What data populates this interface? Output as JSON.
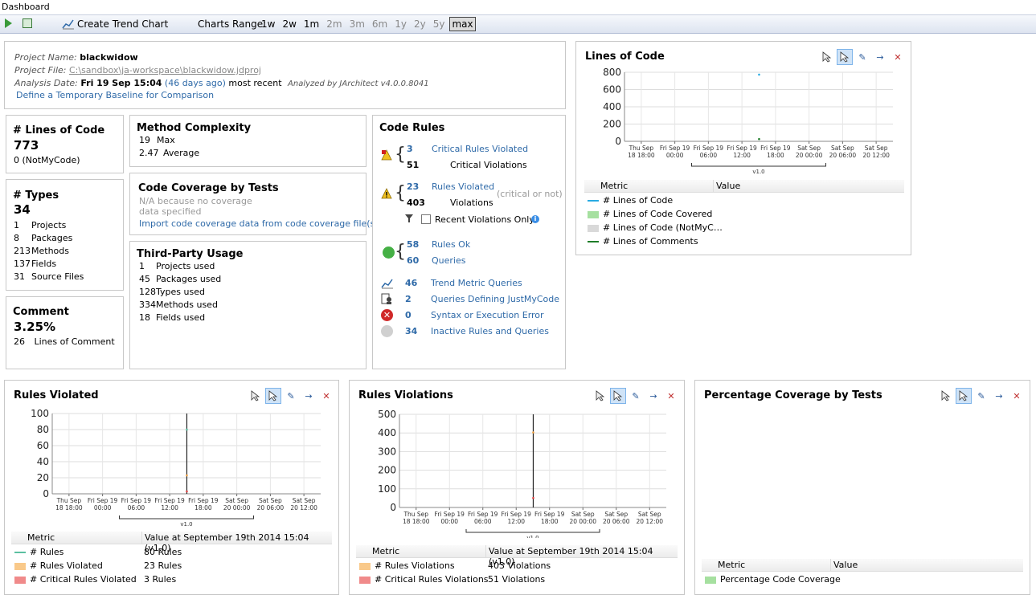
{
  "window": {
    "title": "Dashboard"
  },
  "toolbar": {
    "create_trend_chart": "Create Trend Chart",
    "charts_range_label": "Charts Range:",
    "ranges": [
      "1w",
      "2w",
      "1m",
      "2m",
      "3m",
      "6m",
      "1y",
      "2y",
      "5y",
      "max"
    ],
    "selected_range": "max"
  },
  "project": {
    "name_label": "Project Name:",
    "name": "blackwidow",
    "file_label": "Project File:",
    "file": "C:\\sandbox\\ja-workspace\\blackwidow.jdproj",
    "date_label": "Analysis Date:",
    "date": "Fri 19 Sep  15:04",
    "days_ago": "(46 days ago)",
    "most_recent": "most recent",
    "analyzed_by": "Analyzed by JArchitect v4.0.0.8041",
    "baseline_link": "Define a Temporary Baseline for Comparison"
  },
  "loc": {
    "title": "# Lines of Code",
    "value": "773",
    "notmycode": "0  (NotMyCode)"
  },
  "types": {
    "title": "# Types",
    "value": "34",
    "items": [
      {
        "n": "1",
        "label": "Projects"
      },
      {
        "n": "8",
        "label": "Packages"
      },
      {
        "n": "213",
        "label": "Methods"
      },
      {
        "n": "137",
        "label": "Fields"
      },
      {
        "n": "31",
        "label": "Source Files"
      }
    ]
  },
  "comment": {
    "title": "Comment",
    "value": "3.25%",
    "lines": "26",
    "lines_label": "Lines of Comment"
  },
  "method_complexity": {
    "title": "Method Complexity",
    "max_n": "19",
    "max_label": "Max",
    "avg_n": "2.47",
    "avg_label": "Average"
  },
  "coverage": {
    "title": "Code Coverage by Tests",
    "na1": "N/A because no coverage",
    "na2": "data specified",
    "import_link": "Import code coverage data from code coverage file(s)"
  },
  "third_party": {
    "title": "Third-Party Usage",
    "items": [
      {
        "n": "1",
        "label": "Projects used"
      },
      {
        "n": "45",
        "label": "Packages used"
      },
      {
        "n": "128",
        "label": "Types used"
      },
      {
        "n": "334",
        "label": "Methods used"
      },
      {
        "n": "18",
        "label": "Fields used"
      }
    ]
  },
  "code_rules": {
    "title": "Code Rules",
    "critical_n": "3",
    "critical_label": "Critical Rules Violated",
    "critical_viol_n": "51",
    "critical_viol_label": "Critical Violations",
    "violated_n": "23",
    "violated_label": "Rules Violated",
    "viol_n": "403",
    "viol_label": "Violations",
    "critical_or_not": "(critical or not)",
    "recent_only": "Recent Violations Only",
    "ok_n": "58",
    "ok_label": "Rules Ok",
    "queries_n": "60",
    "queries_label": "Queries",
    "trend_n": "46",
    "trend_label": "Trend Metric Queries",
    "jmc_n": "2",
    "jmc_label": "Queries Defining JustMyCode",
    "syntax_n": "0",
    "syntax_label": "Syntax or Execution Error",
    "inactive_n": "34",
    "inactive_label": "Inactive Rules and Queries"
  },
  "x_ticks": [
    [
      "Thu Sep",
      "18 18:00"
    ],
    [
      "Fri Sep 19",
      "00:00"
    ],
    [
      "Fri Sep 19",
      "06:00"
    ],
    [
      "Fri Sep 19",
      "12:00"
    ],
    [
      "Fri Sep 19",
      "18:00"
    ],
    [
      "Sat Sep",
      "20 00:00"
    ],
    [
      "Sat Sep",
      "20 06:00"
    ],
    [
      "Sat Sep",
      "20 12:00"
    ]
  ],
  "version_label": "v1.0",
  "loc_chart": {
    "title": "Lines of Code",
    "metric_header": "Metric",
    "value_header": "Value",
    "legend": [
      {
        "name": "# Lines of Code",
        "color": "#29abe2",
        "kind": "line",
        "value": ""
      },
      {
        "name": "# Lines of Code Covered",
        "color": "#a6e0a0",
        "kind": "box",
        "value": ""
      },
      {
        "name": "# Lines of Code (NotMyC…",
        "color": "#d9d9d9",
        "kind": "box",
        "value": ""
      },
      {
        "name": "# Lines of Comments",
        "color": "#1e7d28",
        "kind": "line",
        "value": ""
      }
    ]
  },
  "rules_violated_chart": {
    "title": "Rules Violated",
    "metric_header": "Metric",
    "value_header": "Value at September 19th 2014  15:04  (v1.0)",
    "legend": [
      {
        "name": "# Rules",
        "color": "#5bc0a0",
        "kind": "line",
        "value": "80 Rules"
      },
      {
        "name": "# Rules Violated",
        "color": "#f9c98a",
        "kind": "box",
        "value": "23 Rules"
      },
      {
        "name": "# Critical Rules Violated",
        "color": "#f08a8a",
        "kind": "box",
        "value": "3 Rules"
      }
    ]
  },
  "rules_violations_chart": {
    "title": "Rules Violations",
    "metric_header": "Metric",
    "value_header": "Value at September 19th 2014  15:04  (v1.0)",
    "legend": [
      {
        "name": "# Rules Violations",
        "color": "#f9c98a",
        "kind": "box",
        "value": "403 Violations"
      },
      {
        "name": "# Critical Rules Violations",
        "color": "#f08a8a",
        "kind": "box",
        "value": "51 Violations"
      }
    ]
  },
  "coverage_chart": {
    "title": "Percentage Coverage by Tests",
    "metric_header": "Metric",
    "value_header": "Value",
    "legend": [
      {
        "name": "Percentage Code Coverage",
        "color": "#a6e0a0",
        "kind": "box",
        "value": ""
      }
    ]
  },
  "chart_data": [
    {
      "type": "line",
      "title": "Lines of Code",
      "x_ticks": [
        "Thu Sep 18 18:00",
        "Fri Sep 19 00:00",
        "Fri Sep 19 06:00",
        "Fri Sep 19 12:00",
        "Fri Sep 19 18:00",
        "Sat Sep 20 00:00",
        "Sat Sep 20 06:00",
        "Sat Sep 20 12:00"
      ],
      "ylim": [
        0,
        800
      ],
      "yticks": [
        0,
        200,
        400,
        600,
        800
      ],
      "series": [
        {
          "name": "# Lines of Code",
          "x": [
            "Fri Sep 19 15:04"
          ],
          "values": [
            773
          ]
        },
        {
          "name": "# Lines of Comments",
          "x": [
            "Fri Sep 19 15:04"
          ],
          "values": [
            26
          ]
        }
      ]
    },
    {
      "type": "line",
      "title": "Rules Violated",
      "x_ticks": [
        "Thu Sep 18 18:00",
        "Fri Sep 19 00:00",
        "Fri Sep 19 06:00",
        "Fri Sep 19 12:00",
        "Fri Sep 19 18:00",
        "Sat Sep 20 00:00",
        "Sat Sep 20 06:00",
        "Sat Sep 20 12:00"
      ],
      "ylim": [
        0,
        100
      ],
      "yticks": [
        0,
        20,
        40,
        60,
        80,
        100
      ],
      "series": [
        {
          "name": "# Rules",
          "x": [
            "Fri Sep 19 15:04"
          ],
          "values": [
            80
          ]
        },
        {
          "name": "# Rules Violated",
          "x": [
            "Fri Sep 19 15:04"
          ],
          "values": [
            23
          ]
        },
        {
          "name": "# Critical Rules Violated",
          "x": [
            "Fri Sep 19 15:04"
          ],
          "values": [
            3
          ]
        }
      ]
    },
    {
      "type": "line",
      "title": "Rules Violations",
      "x_ticks": [
        "Thu Sep 18 18:00",
        "Fri Sep 19 00:00",
        "Fri Sep 19 06:00",
        "Fri Sep 19 12:00",
        "Fri Sep 19 18:00",
        "Sat Sep 20 00:00",
        "Sat Sep 20 06:00",
        "Sat Sep 20 12:00"
      ],
      "ylim": [
        0,
        500
      ],
      "yticks": [
        0,
        100,
        200,
        300,
        400,
        500
      ],
      "series": [
        {
          "name": "# Rules Violations",
          "x": [
            "Fri Sep 19 15:04"
          ],
          "values": [
            403
          ]
        },
        {
          "name": "# Critical Rules Violations",
          "x": [
            "Fri Sep 19 15:04"
          ],
          "values": [
            51
          ]
        }
      ]
    }
  ]
}
